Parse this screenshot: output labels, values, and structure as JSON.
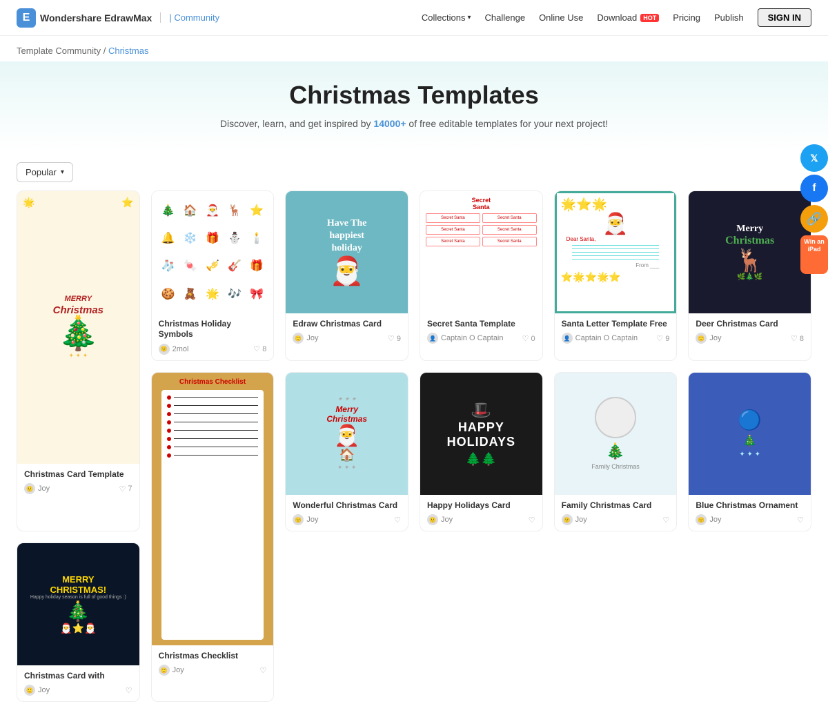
{
  "app": {
    "name": "Wondershare EdrawMax",
    "logo_letter": "E",
    "community_label": "| Community",
    "sign_in": "SIGN IN"
  },
  "nav": {
    "items": [
      {
        "label": "Collections",
        "has_chevron": true
      },
      {
        "label": "Challenge"
      },
      {
        "label": "Online Use"
      },
      {
        "label": "Download",
        "has_hot": true
      },
      {
        "label": "Pricing"
      },
      {
        "label": "Publish"
      }
    ],
    "hot_label": "HOT"
  },
  "breadcrumb": {
    "home": "Template Community",
    "separator": " / ",
    "current": "Christmas"
  },
  "hero": {
    "title": "Christmas Templates",
    "description_prefix": "Discover, learn, and get inspired by ",
    "link_text": "14000+",
    "description_suffix": " of free editable templates for your next project!"
  },
  "filter": {
    "label": "Popular",
    "chevron": "▾"
  },
  "cards": [
    {
      "id": "christmas-card-template",
      "title": "Christmas Card Template",
      "author": "Joy",
      "likes": "7",
      "preview_type": "christmas-card",
      "tall": true
    },
    {
      "id": "christmas-holiday-symbols",
      "title": "Christmas Holiday Symbols",
      "author": "2mol",
      "likes": "8",
      "preview_type": "symbols"
    },
    {
      "id": "edraw-christmas-card",
      "title": "Edraw Christmas Card",
      "author": "Joy",
      "likes": "9",
      "preview_type": "edraw"
    },
    {
      "id": "secret-santa-template",
      "title": "Secret Santa Template",
      "author": "Captain O Captain",
      "likes": "0",
      "preview_type": "secret-santa"
    },
    {
      "id": "santa-letter-template-free",
      "title": "Santa Letter Template Free",
      "author": "Captain O Captain",
      "likes": "9",
      "preview_type": "santa-letter"
    },
    {
      "id": "deer-christmas-card",
      "title": "Deer Christmas Card",
      "author": "Joy",
      "likes": "8",
      "preview_type": "deer"
    },
    {
      "id": "wonderful-christmas-card",
      "title": "Wonderful Christmas Card",
      "author": "Joy",
      "likes": "",
      "preview_type": "wonderful",
      "row2": true
    },
    {
      "id": "christmas-checklist",
      "title": "Christmas Checklist",
      "author": "Joy",
      "likes": "",
      "preview_type": "checklist",
      "row2": true,
      "tall": true
    },
    {
      "id": "happy-holidays",
      "title": "Happy Holidays Card",
      "author": "Joy",
      "likes": "",
      "preview_type": "happy-holidays",
      "row2": true
    },
    {
      "id": "family-christmas-card",
      "title": "Family Christmas Card",
      "author": "Joy",
      "likes": "",
      "preview_type": "family",
      "row2": true
    },
    {
      "id": "blue-ornament",
      "title": "Blue Christmas Ornament",
      "author": "Joy",
      "likes": "",
      "preview_type": "blue",
      "row2": true
    },
    {
      "id": "christmas-card-with",
      "title": "Christmas Card with",
      "author": "Joy",
      "likes": "",
      "preview_type": "merry-night",
      "row2": true
    }
  ],
  "social": {
    "twitter": "𝕏",
    "facebook": "f",
    "link": "🔗",
    "ipad_label": "Win\nan\niPad"
  }
}
